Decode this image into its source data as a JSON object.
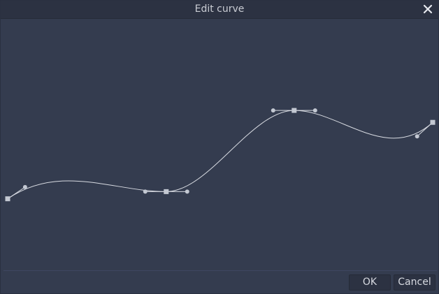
{
  "window": {
    "title": "Edit curve",
    "close_icon": "close-icon"
  },
  "curve_editor": {
    "colors": {
      "background": "#343c4f",
      "curve": "#d8dbe2",
      "point": "#c3c8d2"
    },
    "points": [
      {
        "x": 0.0,
        "y": 0.27,
        "left_tangent": null,
        "right_tangent": 1.2
      },
      {
        "x": 0.373,
        "y": 0.3,
        "left_tangent": 0.0,
        "right_tangent": 0.0
      },
      {
        "x": 0.674,
        "y": 0.64,
        "left_tangent": 0.0,
        "right_tangent": 0.0
      },
      {
        "x": 1.0,
        "y": 0.59,
        "left_tangent": 1.6,
        "right_tangent": null
      }
    ]
  },
  "footer": {
    "ok_label": "OK",
    "cancel_label": "Cancel"
  }
}
